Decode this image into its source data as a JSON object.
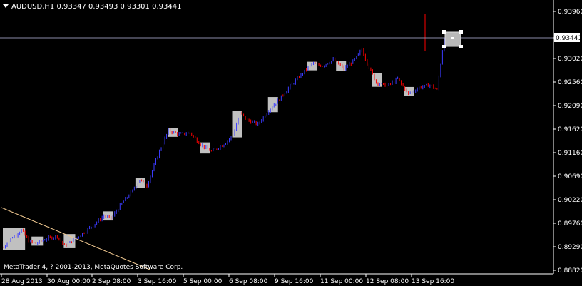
{
  "header": {
    "symbol_timeframe": "AUDUSD,H1",
    "ohlc": "0.93347 0.93493 0.93301 0.93441"
  },
  "copyright": "MetaTrader 4, ? 2001-2013, MetaQuotes Software Corp.",
  "current_price_label": "0.93441",
  "colors": {
    "background": "#000000",
    "up_candle": "#ff0000",
    "down_candle": "#3b3bff",
    "axis": "#ffffff",
    "price_line": "#8a8aa8",
    "trendline": "#f0c890",
    "session_box": "#c0c0c0"
  },
  "chart_data": {
    "type": "candlestick",
    "symbol": "AUDUSD",
    "timeframe": "H1",
    "y_axis_ticks": [
      "0.93960",
      "0.93441",
      "0.93020",
      "0.92560",
      "0.92090",
      "0.91620",
      "0.91160",
      "0.90690",
      "0.90220",
      "0.89760",
      "0.89290",
      "0.88820"
    ],
    "y_range": [
      0.8882,
      0.9396
    ],
    "x_axis_ticks": [
      "28 Aug 2013",
      "30 Aug 00:00",
      "2 Sep 08:00",
      "3 Sep 16:00",
      "5 Sep 00:00",
      "6 Sep 08:00",
      "9 Sep 16:00",
      "11 Sep 00:00",
      "12 Sep 08:00",
      "13 Sep 16:00"
    ],
    "current_price": 0.93441,
    "grid": false,
    "approx_path": [
      [
        0,
        0.8927
      ],
      [
        4,
        0.8945
      ],
      [
        10,
        0.8962
      ],
      [
        14,
        0.894
      ],
      [
        18,
        0.8935
      ],
      [
        24,
        0.8945
      ],
      [
        30,
        0.895
      ],
      [
        34,
        0.893
      ],
      [
        38,
        0.894
      ],
      [
        44,
        0.8955
      ],
      [
        50,
        0.8972
      ],
      [
        56,
        0.899
      ],
      [
        60,
        0.8985
      ],
      [
        66,
        0.9015
      ],
      [
        72,
        0.904
      ],
      [
        76,
        0.9062
      ],
      [
        80,
        0.905
      ],
      [
        86,
        0.911
      ],
      [
        92,
        0.916
      ],
      [
        98,
        0.9152
      ],
      [
        104,
        0.9155
      ],
      [
        110,
        0.9132
      ],
      [
        116,
        0.9118
      ],
      [
        122,
        0.913
      ],
      [
        128,
        0.915
      ],
      [
        132,
        0.9195
      ],
      [
        136,
        0.918
      ],
      [
        142,
        0.9172
      ],
      [
        148,
        0.92
      ],
      [
        154,
        0.9222
      ],
      [
        160,
        0.9248
      ],
      [
        166,
        0.927
      ],
      [
        172,
        0.9292
      ],
      [
        178,
        0.9288
      ],
      [
        184,
        0.93
      ],
      [
        190,
        0.9282
      ],
      [
        196,
        0.93
      ],
      [
        200,
        0.932
      ],
      [
        204,
        0.9285
      ],
      [
        208,
        0.9255
      ],
      [
        214,
        0.9248
      ],
      [
        220,
        0.9262
      ],
      [
        226,
        0.9232
      ],
      [
        232,
        0.9245
      ],
      [
        238,
        0.925
      ],
      [
        242,
        0.924
      ],
      [
        246,
        0.9345
      ],
      [
        250,
        0.933
      ],
      [
        254,
        0.9344
      ]
    ]
  }
}
